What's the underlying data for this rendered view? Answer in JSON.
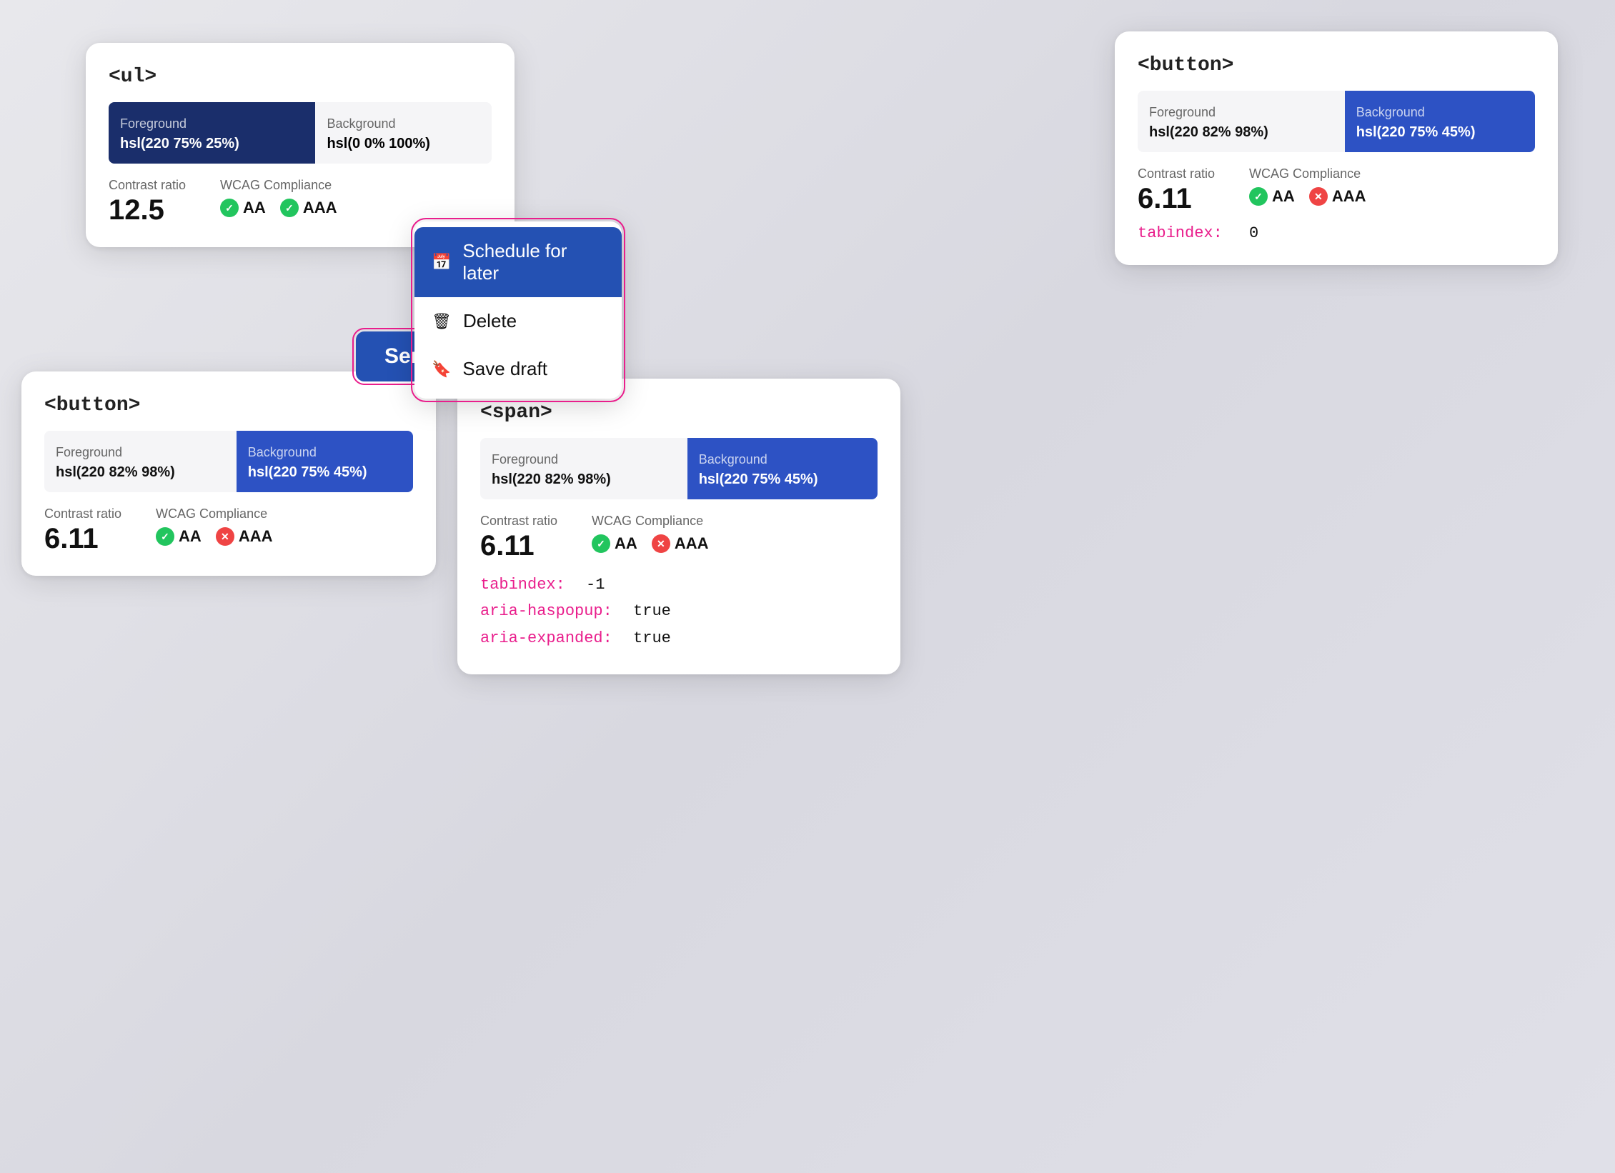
{
  "cards": {
    "ul_card": {
      "title": "<ul>",
      "foreground_label": "Foreground",
      "foreground_value": "hsl(220 75% 25%)",
      "background_label": "Background",
      "background_value": "hsl(0 0% 100%)",
      "contrast_label": "Contrast ratio",
      "contrast_value": "12.5",
      "wcag_label": "WCAG Compliance",
      "wcag_aa": "AA",
      "wcag_aaa": "AAA"
    },
    "button_card_top": {
      "title": "<button>",
      "foreground_label": "Foreground",
      "foreground_value": "hsl(220 82% 98%)",
      "background_label": "Background",
      "background_value": "hsl(220 75% 45%)",
      "contrast_label": "Contrast ratio",
      "contrast_value": "6.11",
      "wcag_label": "WCAG Compliance",
      "wcag_aa": "AA",
      "wcag_aaa": "AAA",
      "tabindex_label": "tabindex:",
      "tabindex_value": "0"
    },
    "button_card_bottom": {
      "title": "<button>",
      "foreground_label": "Foreground",
      "foreground_value": "hsl(220 82% 98%)",
      "background_label": "Background",
      "background_value": "hsl(220 75% 45%)",
      "contrast_label": "Contrast ratio",
      "contrast_value": "6.11",
      "wcag_label": "WCAG Compliance",
      "wcag_aa": "AA",
      "wcag_aaa": "AAA"
    },
    "span_card": {
      "title": "<span>",
      "foreground_label": "Foreground",
      "foreground_value": "hsl(220 82% 98%)",
      "background_label": "Background",
      "background_value": "hsl(220 75% 45%)",
      "contrast_label": "Contrast ratio",
      "contrast_value": "6.11",
      "wcag_label": "WCAG Compliance",
      "wcag_aa": "AA",
      "wcag_aaa": "AAA",
      "tabindex_label": "tabindex:",
      "tabindex_value": "-1",
      "aria_haspopup_label": "aria-haspopup:",
      "aria_haspopup_value": "true",
      "aria_expanded_label": "aria-expanded:",
      "aria_expanded_value": "true"
    }
  },
  "dropdown": {
    "schedule_label": "Schedule for later",
    "delete_label": "Delete",
    "save_draft_label": "Save draft"
  },
  "send_button": {
    "send_label": "Send",
    "caret_symbol": "⌃"
  },
  "colors": {
    "blue_dark": "#1a2e6b",
    "blue_medium": "#2d52c4",
    "accent_pink": "#e91e8c",
    "white": "#ffffff",
    "check_green": "#22c55e",
    "check_red": "#ef4444"
  }
}
